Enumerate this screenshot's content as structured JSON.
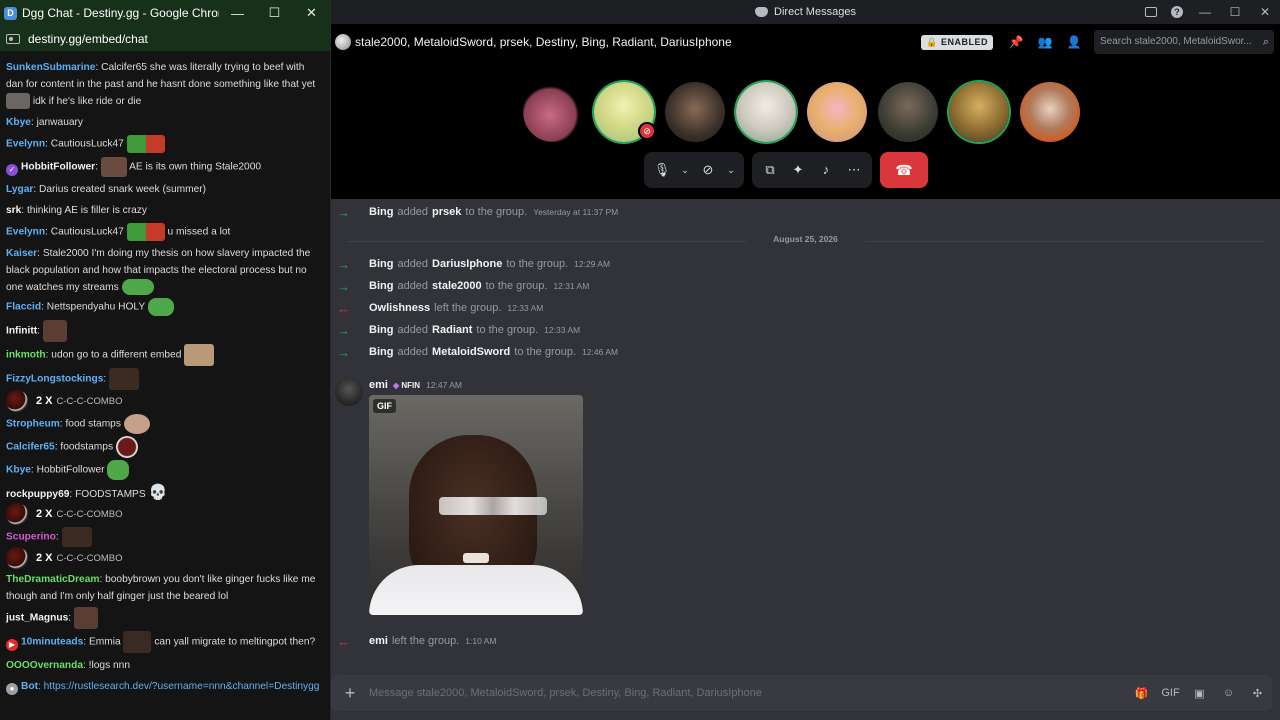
{
  "chrome": {
    "window_title": "Dgg Chat - Destiny.gg - Google Chrome",
    "favicon_letter": "D",
    "url": "destiny.gg/embed/chat",
    "minimize": "—",
    "maximize": "☐",
    "close": "✕"
  },
  "chat": {
    "m1": {
      "user": "SunkenSubmarine",
      "text": ": Calcifer65 she was literally trying to beef with dan for content in the past and he hasnt done something like that yet",
      "tail": "idk if he's like ride or die",
      "color": "#5fb0f5"
    },
    "m2": {
      "user": "Kbye",
      "text": ": janwauary",
      "color": "#5fb0f5"
    },
    "m3": {
      "user": "Evelynn",
      "text": ": CautiousLuck47",
      "color": "#5fb0f5"
    },
    "m4": {
      "user": "HobbitFollower",
      "text": "AE is its own thing Stale2000",
      "color": "#f2f3f5"
    },
    "m5": {
      "user": "Lygar",
      "text": ": Darius created snark week (summer)",
      "color": "#5fb0f5"
    },
    "m6": {
      "user": "srk",
      "text": ": thinking AE is filler is crazy",
      "color": "#f2f3f5"
    },
    "m7": {
      "user": "Evelynn",
      "text": ": CautiousLuck47",
      "tail": "u missed a lot",
      "color": "#5fb0f5"
    },
    "m8": {
      "user": "Kaiser",
      "text": ": Stale2000 I'm doing my thesis on how slavery impacted the black population and how that impacts the electoral process but no one watches my streams",
      "color": "#5fb0f5"
    },
    "m9": {
      "user": "Flaccid",
      "text": ": Nettspendyahu HOLY",
      "color": "#5fb0f5"
    },
    "m10": {
      "user": "Infinitt",
      "text": ":",
      "color": "#f2f3f5"
    },
    "m11": {
      "user": "inkmoth",
      "text": ": udon go to a different embed",
      "color": "#6adf6a"
    },
    "m12": {
      "user": "FizzyLongstockings",
      "text": ":",
      "color": "#5fb0f5"
    },
    "combo1": {
      "count": "2 X",
      "label": "C-C-C-COMBO"
    },
    "m13": {
      "user": "Stropheum",
      "text": ": food stamps",
      "color": "#5fb0f5"
    },
    "m14": {
      "user": "Calcifer65",
      "text": ": foodstamps",
      "color": "#5fb0f5"
    },
    "m15": {
      "user": "Kbye",
      "text": ": HobbitFollower",
      "color": "#5fb0f5"
    },
    "m16": {
      "user": "rockpuppy69",
      "text": ": FOODSTAMPS",
      "color": "#f2f3f5"
    },
    "combo2": {
      "count": "2 X",
      "label": "C-C-C-COMBO"
    },
    "m17": {
      "user": "Scuperino",
      "text": ":",
      "color": "#d45bd4"
    },
    "combo3": {
      "count": "2 X",
      "label": "C-C-C-COMBO"
    },
    "m18": {
      "user": "TheDramaticDream",
      "text": ": boobybrown you don't like ginger fucks like me though and I'm only half ginger just the beared lol",
      "color": "#6adf6a"
    },
    "m19": {
      "user": "just_Magnus",
      "text": ":",
      "color": "#f2f3f5"
    },
    "m20": {
      "user": "10minuteads",
      "text": ": Emmia",
      "tail": "can yall migrate to meltingpot then?",
      "color": "#5fb0f5"
    },
    "m21": {
      "user": "OOOOvernanda",
      "text": ": !logs nnn",
      "color": "#6adf6a"
    },
    "m22": {
      "user": "Bot",
      "text": ": https://rustlesearch.dev/?username=nnn&channel=Destinygg",
      "color": "#5fb0f5"
    }
  },
  "discord": {
    "title": "Direct Messages",
    "group_name": "stale2000, MetaloidSword, prsek, Destiny, Bing, Radiant, DariusIphone",
    "enabled_badge": "ENABLED",
    "search_placeholder": "Search stale2000, MetaloidSwor...",
    "composer_placeholder": "Message stale2000, MetaloidSword, prsek, Destiny, Bing, Radiant, DariusIphone",
    "date_divider": "August 25, 2026",
    "system": [
      {
        "name": "Bing",
        "text": "added",
        "target": "prsek",
        "tail": "to the group.",
        "time": "Yesterday at 11:37 PM"
      },
      {
        "name": "Bing",
        "text": "added",
        "target": "DariusIphone",
        "tail": "to the group.",
        "time": "12:29 AM"
      },
      {
        "name": "Bing",
        "text": "added",
        "target": "stale2000",
        "tail": "to the group.",
        "time": "12:31 AM"
      },
      {
        "name": "Owlishness",
        "text": "left the group.",
        "time": "12:33 AM"
      },
      {
        "name": "Bing",
        "text": "added",
        "target": "Radiant",
        "tail": "to the group.",
        "time": "12:33 AM"
      },
      {
        "name": "Bing",
        "text": "added",
        "target": "MetaloidSword",
        "tail": "to the group.",
        "time": "12:46 AM"
      },
      {
        "name": "emi",
        "text": "left the group.",
        "time": "1:10 AM"
      }
    ],
    "message": {
      "author": "emi",
      "tag": "NFIN",
      "time": "12:47 AM",
      "gif_label": "GIF"
    }
  }
}
